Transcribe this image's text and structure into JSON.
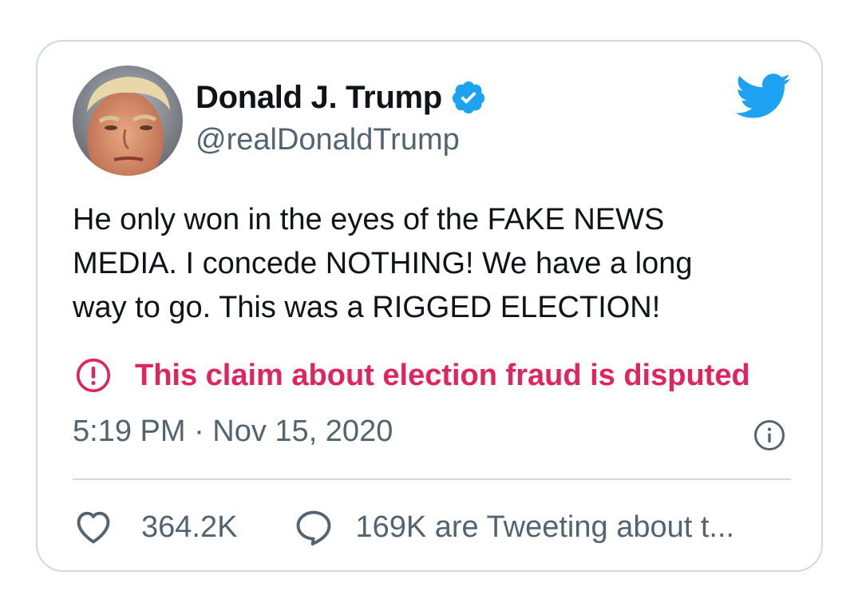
{
  "author": {
    "name": "Donald J. Trump",
    "handle": "@realDonaldTrump",
    "verified": true
  },
  "tweet": {
    "lines": [
      "He only won in the eyes of the FAKE NEWS",
      "MEDIA. I concede NOTHING! We have a long",
      "way to go. This was a RIGGED ELECTION!"
    ]
  },
  "label": {
    "text": "This claim about election fraud is disputed",
    "icon": "exclamation-circle-icon"
  },
  "meta": {
    "timestamp": "5:19 PM · Nov 15, 2020"
  },
  "actions": {
    "likes": "364.2K",
    "conversation": "169K are Tweeting about t..."
  },
  "colors": {
    "text_primary": "#0f1419",
    "text_secondary": "#536471",
    "twitter_blue": "#1da1f2",
    "disputed_red": "#e0245e",
    "border": "#cfd9de"
  }
}
